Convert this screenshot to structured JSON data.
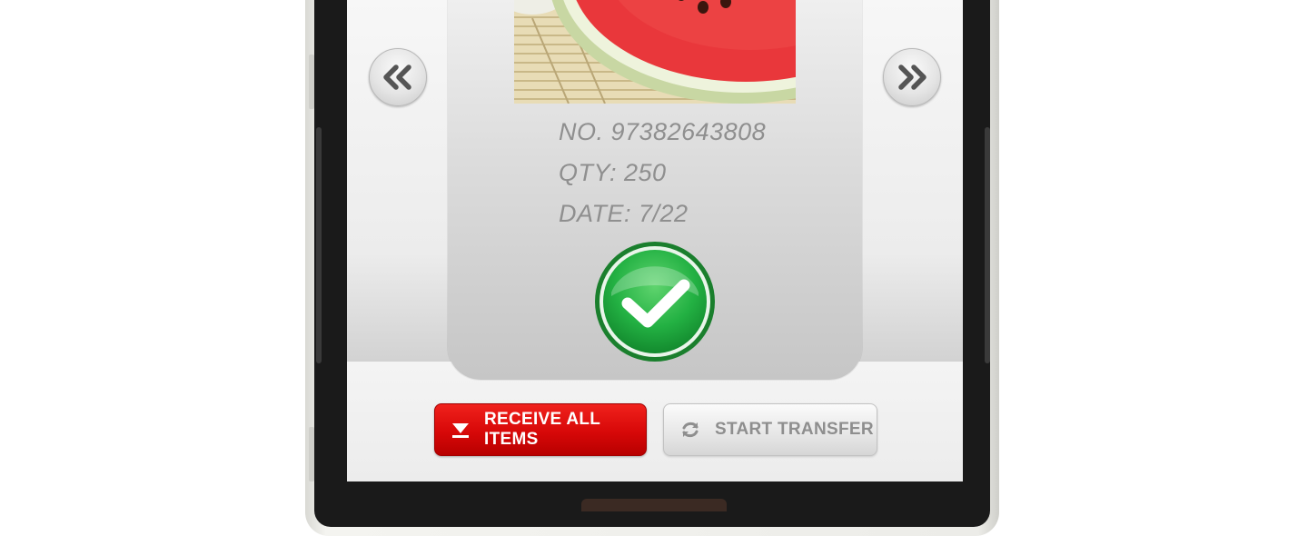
{
  "item": {
    "number": "NO. 97382643808",
    "quantity": "QTY: 250",
    "date": "DATE: 7/22",
    "image": "watermelon-slice-on-bamboo-mat"
  },
  "nav": {
    "prev_icon": "double-chevron-left-icon",
    "next_icon": "double-chevron-right-icon"
  },
  "status": {
    "icon": "checkmark-icon",
    "color": "#22b04a"
  },
  "actions": {
    "receive_label": "RECEIVE ALL ITEMS",
    "receive_icon": "download-arrow-icon",
    "receive_color": "#d70808",
    "transfer_label": "START TRANSFER",
    "transfer_icon": "refresh-icon"
  }
}
